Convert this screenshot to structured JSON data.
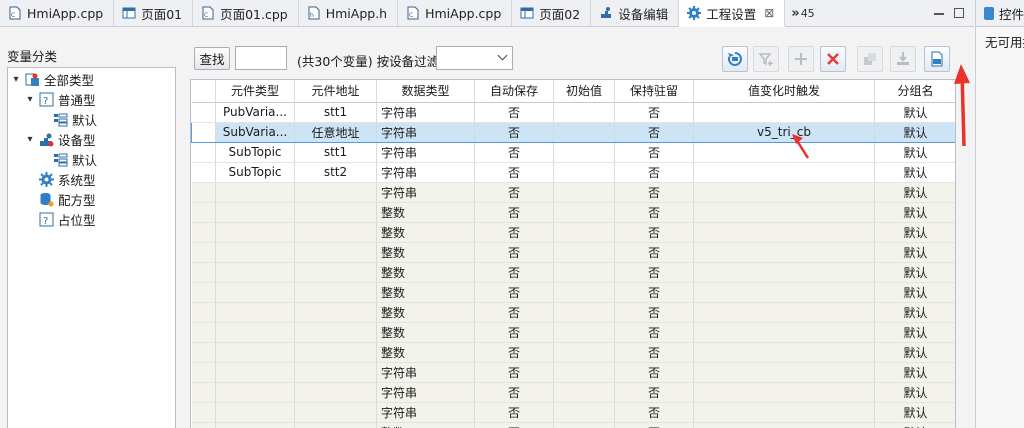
{
  "tabs": [
    {
      "label": "HmiApp.cpp",
      "icon": "cpp-file-icon",
      "active": false
    },
    {
      "label": "页面01",
      "icon": "page-icon",
      "active": false
    },
    {
      "label": "页面01.cpp",
      "icon": "cpp-file-icon",
      "active": false
    },
    {
      "label": "HmiApp.h",
      "icon": "header-file-icon",
      "active": false
    },
    {
      "label": "HmiApp.cpp",
      "icon": "cpp-file-icon",
      "active": false
    },
    {
      "label": "页面02",
      "icon": "page-icon",
      "active": false
    },
    {
      "label": "设备编辑",
      "icon": "device-icon",
      "active": false
    },
    {
      "label": "工程设置",
      "icon": "gear-icon",
      "active": true
    }
  ],
  "tab_overflow": {
    "chevrons": "»",
    "count": "45"
  },
  "right_panel": {
    "title": "控件",
    "message": "无可用控件"
  },
  "tree": {
    "title": "变量分类",
    "nodes": [
      {
        "label": "全部类型",
        "icon": "all-types-icon",
        "toggle": "▾"
      },
      {
        "label": "普通型",
        "icon": "question-box-icon",
        "toggle": "▾"
      },
      {
        "label": "默认",
        "icon": "group-icon",
        "toggle": ""
      },
      {
        "label": "设备型",
        "icon": "device-icon",
        "toggle": "▾"
      },
      {
        "label": "默认",
        "icon": "group-icon",
        "toggle": ""
      },
      {
        "label": "系统型",
        "icon": "gear-icon",
        "toggle": ""
      },
      {
        "label": "配方型",
        "icon": "database-icon",
        "toggle": ""
      },
      {
        "label": "占位型",
        "icon": "question-box-icon",
        "toggle": ""
      }
    ]
  },
  "toolbar": {
    "find_label": "查找",
    "find_value": "",
    "count_label": "(共30个变量) 按设备过滤",
    "filter_value": ""
  },
  "toolbar_icons": [
    "refresh-icon",
    "filter-icon",
    "add-icon",
    "delete-icon",
    "copy-icon",
    "import-icon",
    "export-object-icon"
  ],
  "grid": {
    "columns": [
      "",
      "元件类型",
      "元件地址",
      "数据类型",
      "自动保存",
      "初始值",
      "保持驻留",
      "值变化时触发",
      "分组名"
    ],
    "rows": [
      [
        "",
        "PubVaria...",
        "stt1",
        "字符串",
        "否",
        "",
        "否",
        "",
        "默认"
      ],
      [
        "",
        "SubVaria...",
        "任意地址",
        "字符串",
        "否",
        "",
        "否",
        "v5_tri_cb",
        "默认"
      ],
      [
        "",
        "SubTopic",
        "stt1",
        "字符串",
        "否",
        "",
        "否",
        "",
        "默认"
      ],
      [
        "",
        "SubTopic",
        "stt2",
        "字符串",
        "否",
        "",
        "否",
        "",
        "默认"
      ],
      [
        "",
        "",
        "",
        "字符串",
        "否",
        "",
        "否",
        "",
        "默认"
      ],
      [
        "",
        "",
        "",
        "整数",
        "否",
        "",
        "否",
        "",
        "默认"
      ],
      [
        "",
        "",
        "",
        "整数",
        "否",
        "",
        "否",
        "",
        "默认"
      ],
      [
        "",
        "",
        "",
        "整数",
        "否",
        "",
        "否",
        "",
        "默认"
      ],
      [
        "",
        "",
        "",
        "整数",
        "否",
        "",
        "否",
        "",
        "默认"
      ],
      [
        "",
        "",
        "",
        "整数",
        "否",
        "",
        "否",
        "",
        "默认"
      ],
      [
        "",
        "",
        "",
        "整数",
        "否",
        "",
        "否",
        "",
        "默认"
      ],
      [
        "",
        "",
        "",
        "整数",
        "否",
        "",
        "否",
        "",
        "默认"
      ],
      [
        "",
        "",
        "",
        "整数",
        "否",
        "",
        "否",
        "",
        "默认"
      ],
      [
        "",
        "",
        "",
        "字符串",
        "否",
        "",
        "否",
        "",
        "默认"
      ],
      [
        "",
        "",
        "",
        "字符串",
        "否",
        "",
        "否",
        "",
        "默认"
      ],
      [
        "",
        "",
        "",
        "字符串",
        "否",
        "",
        "否",
        "",
        "默认"
      ],
      [
        "",
        "",
        "",
        "整数",
        "否",
        "",
        "否",
        "",
        "默认"
      ]
    ],
    "selected_row": 1
  },
  "colors": {
    "annotation_arrow": "#e8322a",
    "selection": "#cde4f7",
    "selection_border": "#5a9ad8"
  }
}
